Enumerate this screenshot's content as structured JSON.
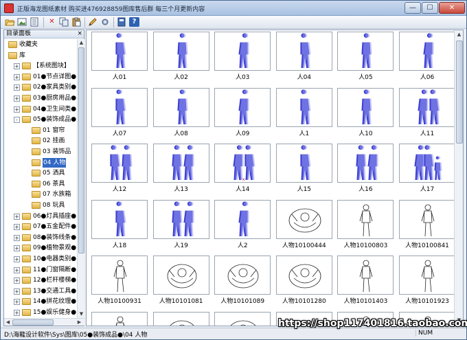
{
  "window": {
    "title": "正版海龙图纸素材 购买进476928859图库售后群 每三个月更新内容",
    "min_glyph": "—",
    "max_glyph": "☐",
    "close_glyph": "✕"
  },
  "toolbar": {
    "icons": [
      "open-folder-icon",
      "image-icon",
      "document-icon",
      "delete-icon",
      "copy-icon",
      "paste-icon",
      "pencil-icon",
      "settings-icon",
      "book-icon",
      "help-icon"
    ],
    "help_glyph": "?",
    "delete_glyph": "✕"
  },
  "panel": {
    "title": "目录面板",
    "close_glyph": "×"
  },
  "tree": [
    {
      "label": "收藏夹",
      "level": 0,
      "expander": "",
      "selected": false
    },
    {
      "label": "库",
      "level": 0,
      "expander": "",
      "selected": false
    },
    {
      "label": "【系统图块】",
      "level": 1,
      "expander": "+",
      "selected": false
    },
    {
      "label": "01●节点详图●",
      "level": 1,
      "expander": "+",
      "selected": false
    },
    {
      "label": "02●家具类别●",
      "level": 1,
      "expander": "+",
      "selected": false
    },
    {
      "label": "03●厨房用品●",
      "level": 1,
      "expander": "+",
      "selected": false
    },
    {
      "label": "04●卫生间类●",
      "level": 1,
      "expander": "+",
      "selected": false
    },
    {
      "label": "05●装饰成品●",
      "level": 1,
      "expander": "-",
      "selected": false
    },
    {
      "label": "01 窗帘",
      "level": 2,
      "expander": "",
      "selected": false
    },
    {
      "label": "02 挂画",
      "level": 2,
      "expander": "",
      "selected": false
    },
    {
      "label": "03 装饰品",
      "level": 2,
      "expander": "",
      "selected": false
    },
    {
      "label": "04 人物",
      "level": 2,
      "expander": "",
      "selected": true
    },
    {
      "label": "05 洒具",
      "level": 2,
      "expander": "",
      "selected": false
    },
    {
      "label": "06 茶具",
      "level": 2,
      "expander": "",
      "selected": false
    },
    {
      "label": "07 水族箱",
      "level": 2,
      "expander": "",
      "selected": false
    },
    {
      "label": "08 玩具",
      "level": 2,
      "expander": "",
      "selected": false
    },
    {
      "label": "06●灯具插座●",
      "level": 1,
      "expander": "+",
      "selected": false
    },
    {
      "label": "07●五金配件●",
      "level": 1,
      "expander": "+",
      "selected": false
    },
    {
      "label": "08●装饰线条●",
      "level": 1,
      "expander": "+",
      "selected": false
    },
    {
      "label": "09●植物景观●",
      "level": 1,
      "expander": "+",
      "selected": false
    },
    {
      "label": "10●电器类别●",
      "level": 1,
      "expander": "+",
      "selected": false
    },
    {
      "label": "11●门窗隔断●",
      "level": 1,
      "expander": "+",
      "selected": false
    },
    {
      "label": "12●栏杆楼梯●",
      "level": 1,
      "expander": "+",
      "selected": false
    },
    {
      "label": "13●交通工具●",
      "level": 1,
      "expander": "+",
      "selected": false
    },
    {
      "label": "14●拼花纹理●",
      "level": 1,
      "expander": "+",
      "selected": false
    },
    {
      "label": "15●娱乐健身●",
      "level": 1,
      "expander": "+",
      "selected": false
    },
    {
      "label": "16●动态图块●",
      "level": 1,
      "expander": "+",
      "selected": false
    }
  ],
  "items": [
    {
      "label": "人01",
      "style": "silhouette",
      "people": 1
    },
    {
      "label": "人02",
      "style": "silhouette",
      "people": 1
    },
    {
      "label": "人03",
      "style": "silhouette",
      "people": 1
    },
    {
      "label": "人04",
      "style": "silhouette",
      "people": 1
    },
    {
      "label": "人05",
      "style": "silhouette",
      "people": 1
    },
    {
      "label": "人06",
      "style": "silhouette",
      "people": 1
    },
    {
      "label": "人07",
      "style": "silhouette",
      "people": 1
    },
    {
      "label": "人08",
      "style": "silhouette",
      "people": 1
    },
    {
      "label": "人09",
      "style": "silhouette",
      "people": 1
    },
    {
      "label": "人1",
      "style": "silhouette",
      "people": 1
    },
    {
      "label": "人10",
      "style": "silhouette",
      "people": 1
    },
    {
      "label": "人11",
      "style": "silhouette",
      "people": 2
    },
    {
      "label": "人12",
      "style": "silhouette",
      "people": 2
    },
    {
      "label": "人13",
      "style": "silhouette",
      "people": 2
    },
    {
      "label": "人14",
      "style": "silhouette",
      "people": 2
    },
    {
      "label": "人15",
      "style": "silhouette",
      "people": 1
    },
    {
      "label": "人16",
      "style": "silhouette",
      "people": 2
    },
    {
      "label": "人17",
      "style": "silhouette",
      "people": 3
    },
    {
      "label": "人18",
      "style": "silhouette",
      "people": 1
    },
    {
      "label": "人19",
      "style": "silhouette",
      "people": 2
    },
    {
      "label": "人2",
      "style": "silhouette",
      "people": 1
    },
    {
      "label": "人物10100444",
      "style": "line",
      "people": 1
    },
    {
      "label": "人物10100803",
      "style": "line",
      "people": 1
    },
    {
      "label": "人物10100841",
      "style": "line",
      "people": 1
    },
    {
      "label": "人物10100931",
      "style": "line",
      "people": 1
    },
    {
      "label": "人物10101081",
      "style": "line",
      "people": 1
    },
    {
      "label": "人物10101089",
      "style": "line",
      "people": 1
    },
    {
      "label": "人物10101280",
      "style": "line",
      "people": 1
    },
    {
      "label": "人物10101403",
      "style": "line",
      "people": 1
    },
    {
      "label": "人物10101923",
      "style": "line",
      "people": 1
    },
    {
      "label": "",
      "style": "line",
      "people": 1
    },
    {
      "label": "",
      "style": "line",
      "people": 1
    },
    {
      "label": "",
      "style": "line",
      "people": 1
    },
    {
      "label": "",
      "style": "line",
      "people": 1
    },
    {
      "label": "",
      "style": "line",
      "people": 1
    },
    {
      "label": "",
      "style": "line",
      "people": 1
    }
  ],
  "status": {
    "path": "D:\\海龍设计软件\\Sys\\图库\\05●装饰成品●\\04 人物",
    "num": "NUM"
  },
  "watermark": "https://shop117401816.taobao.com",
  "colors": {
    "silhouette_fill": "#3b3fd0",
    "silhouette_light": "#9a9cf0",
    "line_stroke": "#222222",
    "selection": "#3369c4"
  }
}
